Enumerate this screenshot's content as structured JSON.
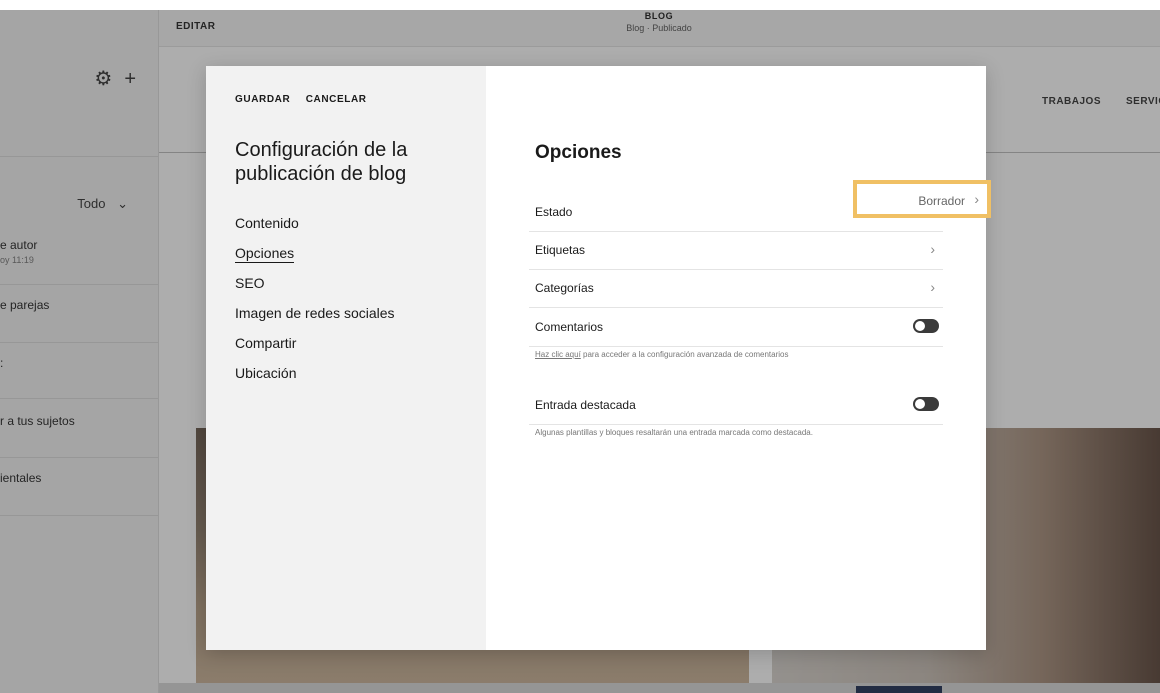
{
  "sidebar": {
    "gear_icon": "gear-icon",
    "add_icon": "plus-icon",
    "filter_label": "Todo",
    "items": [
      {
        "title": "e autor",
        "subtitle": "oy 11:19"
      },
      {
        "title": "e parejas",
        "subtitle": ""
      },
      {
        "title": ":",
        "subtitle": ""
      },
      {
        "title": "r a tus sujetos",
        "subtitle": ""
      },
      {
        "title": "ientales",
        "subtitle": ""
      }
    ]
  },
  "topbar": {
    "edit_label": "EDITAR",
    "page_title": "BLOG",
    "page_status": "Blog · Publicado"
  },
  "site": {
    "nav": [
      "TRABAJOS",
      "SERVIC"
    ]
  },
  "modal": {
    "save_label": "GUARDAR",
    "cancel_label": "CANCELAR",
    "title": "Configuración de la publicación de blog",
    "nav": [
      "Contenido",
      "Opciones",
      "SEO",
      "Imagen de redes sociales",
      "Compartir",
      "Ubicación"
    ],
    "active_nav": "Opciones",
    "section_title": "Opciones",
    "status": {
      "label": "Estado",
      "value": "Borrador"
    },
    "tags_label": "Etiquetas",
    "categories_label": "Categorías",
    "comments_label": "Comentarios",
    "comments_note_link": "Haz clic aquí",
    "comments_note_text": " para acceder a la configuración avanzada de comentarios",
    "featured_label": "Entrada destacada",
    "featured_note": "Algunas plantillas y bloques resaltarán una entrada marcada como destacada."
  },
  "colors": {
    "highlight": "#f0c064",
    "toggle_off": "#3a3a3a",
    "left_panel": "#f2f2f2"
  }
}
